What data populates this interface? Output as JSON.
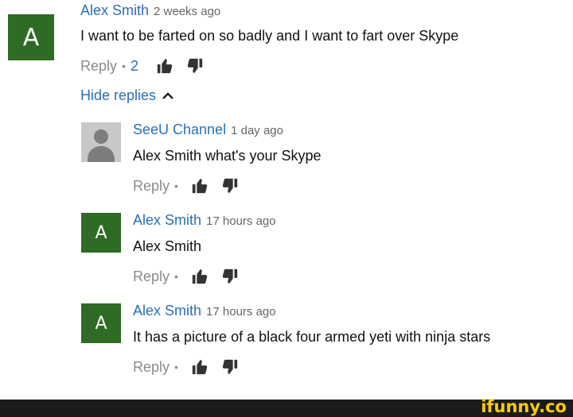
{
  "comments": [
    {
      "author": "Alex Smith",
      "time": "2 weeks ago",
      "text": "I want to be farted on so badly and I want to fart over Skype",
      "avatar_letter": "A",
      "reply_label": "Reply",
      "reply_count": "2"
    }
  ],
  "hide_replies_label": "Hide replies",
  "replies": [
    {
      "author": "SeeU Channel",
      "time": "1 day ago",
      "text": "Alex Smith what's your Skype",
      "avatar_type": "default",
      "reply_label": "Reply"
    },
    {
      "author": "Alex Smith",
      "time": "17 hours ago",
      "text": "Alex Smith",
      "avatar_letter": "A",
      "reply_label": "Reply"
    },
    {
      "author": "Alex Smith",
      "time": "17 hours ago",
      "text": "It has a picture of a black four armed yeti with ninja stars",
      "avatar_letter": "A",
      "reply_label": "Reply"
    }
  ],
  "footer": {
    "brand": "ifunny.co"
  },
  "icons": {
    "like": "thumbs-up-icon",
    "dislike": "thumbs-down-icon",
    "chevron": "chevron-up-icon"
  },
  "colors": {
    "avatar_green": "#2e6b24",
    "author_blue": "#2a6fb4",
    "footer_bg": "#1b1b1b",
    "brand_yellow": "#ffcc00"
  }
}
